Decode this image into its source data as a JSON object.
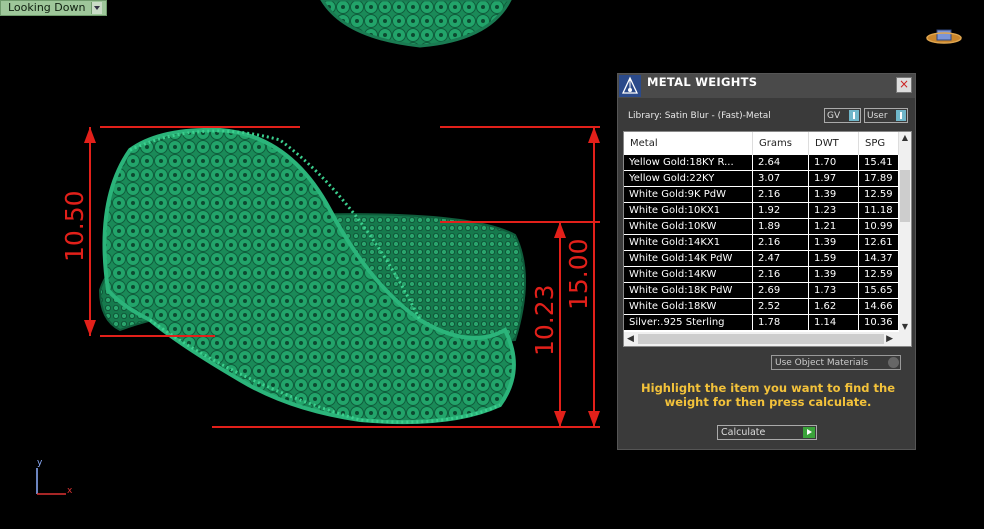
{
  "viewport": {
    "view_label": "Looking Down",
    "dimensions": [
      "10.50",
      "10.23",
      "15.00"
    ],
    "axis_y": "y",
    "axis_x": "x"
  },
  "panel": {
    "title": "METAL WEIGHTS",
    "library": "Library: Satin Blur - (Fast)-Metal",
    "toggle_gv": "GV",
    "toggle_user": "User",
    "columns": [
      "Metal",
      "Grams",
      "DWT",
      "SPG"
    ],
    "rows": [
      [
        "Yellow Gold:18KY R...",
        "2.64",
        "1.70",
        "15.41"
      ],
      [
        "Yellow Gold:22KY",
        "3.07",
        "1.97",
        "17.89"
      ],
      [
        "White Gold:9K PdW",
        "2.16",
        "1.39",
        "12.59"
      ],
      [
        "White Gold:10KX1",
        "1.92",
        "1.23",
        "11.18"
      ],
      [
        "White Gold:10KW",
        "1.89",
        "1.21",
        "10.99"
      ],
      [
        "White Gold:14KX1",
        "2.16",
        "1.39",
        "12.61"
      ],
      [
        "White Gold:14K PdW",
        "2.47",
        "1.59",
        "14.37"
      ],
      [
        "White Gold:14KW",
        "2.16",
        "1.39",
        "12.59"
      ],
      [
        "White Gold:18K PdW",
        "2.69",
        "1.73",
        "15.65"
      ],
      [
        "White Gold:18KW",
        "2.52",
        "1.62",
        "14.66"
      ],
      [
        "Silver:.925 Sterling",
        "1.78",
        "1.14",
        "10.36"
      ]
    ],
    "use_object_materials": "Use Object Materials",
    "hint": "Highlight the item you want to find the weight for then press calculate.",
    "calculate": "Calculate"
  },
  "colors": {
    "dimension": "#e2201a",
    "ring": "#1f8f5e",
    "hint": "#f3c23a"
  },
  "icons": [
    "dropdown-arrow-icon",
    "metal-weights-logo-icon",
    "close-icon",
    "navigation-cube-icon",
    "play-icon"
  ]
}
